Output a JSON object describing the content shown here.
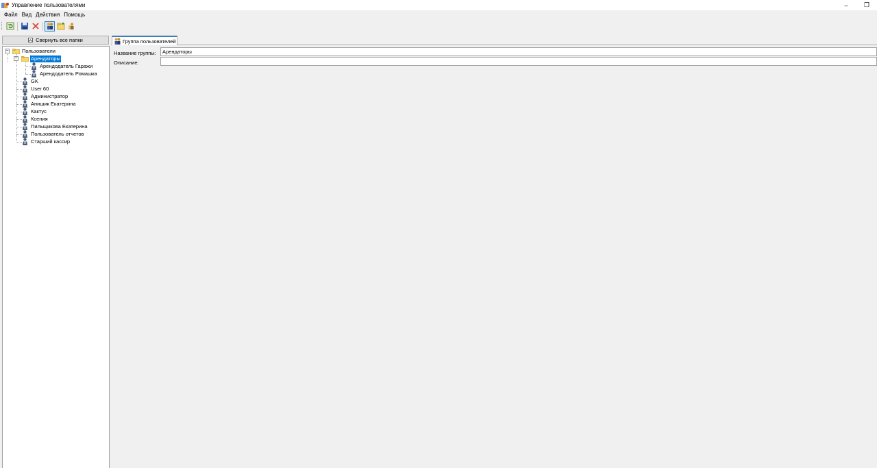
{
  "window": {
    "title": "Управление пользователями",
    "minimize_glyph": "–",
    "restore_glyph": "❐"
  },
  "menu": [
    "Файл",
    "Вид",
    "Действия",
    "Помощь"
  ],
  "toolbar": {
    "icons": [
      "refresh-icon",
      "save-icon",
      "delete-icon",
      "users-group-icon",
      "new-folder-icon",
      "add-user-icon"
    ],
    "pressed": "users-group-icon"
  },
  "left_panel": {
    "collapse_label": "Свернуть все папки",
    "tree": {
      "root": "Пользователи",
      "group": "Арендаторы",
      "group_children": [
        "Арендодатель Гаражи",
        "Арендодатель Ромашка"
      ],
      "users": [
        "GK",
        "User 60",
        "Администратор",
        "Анишик Екатерина",
        "Кактус",
        "Ксения",
        "Пильщикова Екатерина",
        "Пользователь отчетов",
        "Старший кассир"
      ]
    },
    "selected": "Арендаторы"
  },
  "right_panel": {
    "tab_label": "Группа пользователей",
    "group_name_label": "Название группы:",
    "group_name_value": "Арендаторы",
    "description_label": "Описание:",
    "description_value": ""
  },
  "colors": {
    "selection": "#0078d7",
    "folder": "#f5d76e",
    "user_icon": "#4a5a78"
  }
}
